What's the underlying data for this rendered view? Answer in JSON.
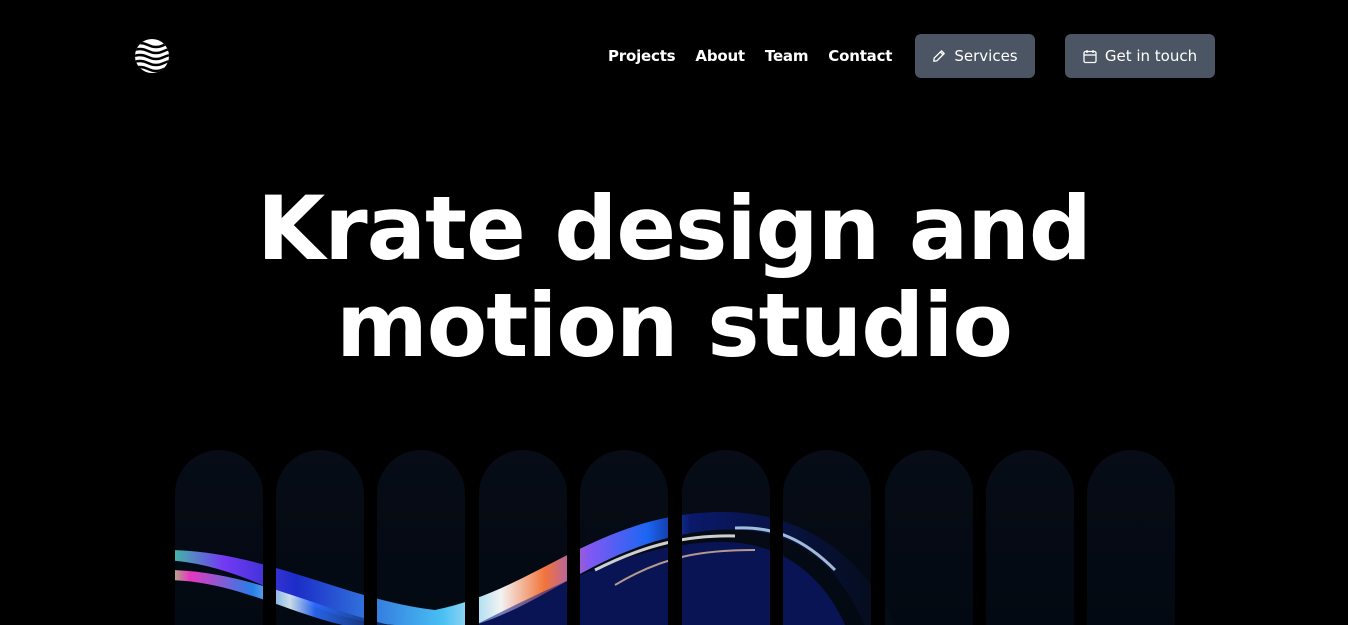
{
  "brand": {
    "logo_icon": "wave-globe-icon"
  },
  "nav": {
    "items": [
      {
        "label": "Projects"
      },
      {
        "label": "About"
      },
      {
        "label": "Team"
      },
      {
        "label": "Contact"
      }
    ]
  },
  "actions": {
    "services": {
      "label": "Services",
      "icon": "pencil-icon"
    },
    "contact": {
      "label": "Get in touch",
      "icon": "calendar-icon"
    }
  },
  "hero": {
    "title_line1": "Krate design and",
    "title_line2": "motion studio"
  },
  "colors": {
    "background": "#000000",
    "button": "#4b5563",
    "text": "#ffffff",
    "pillar": "#050b14"
  }
}
